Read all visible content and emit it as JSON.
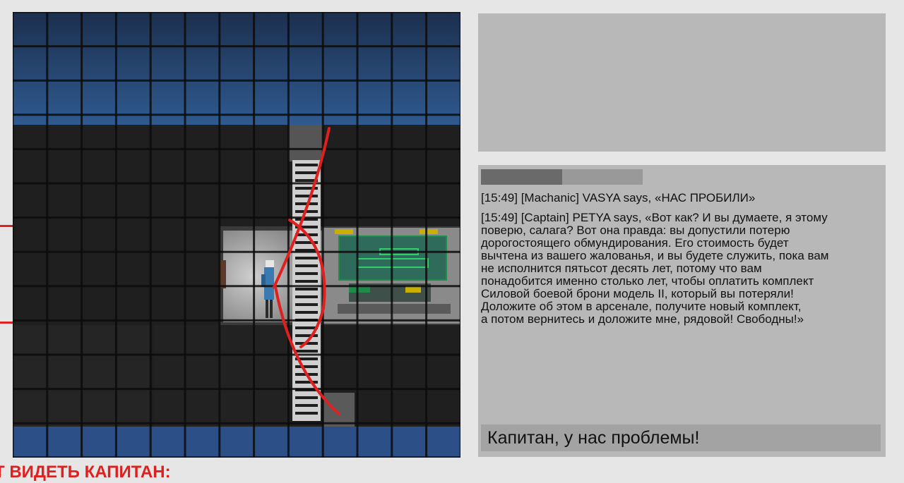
{
  "game": {
    "scene": "space-station-corridor",
    "sprites": [
      "captain-character",
      "ladder",
      "control-console",
      "red-annotation-lines"
    ],
    "colors": {
      "space": "#2a4c7a",
      "floor": "#1e1e1e",
      "room": "#9a9a9a",
      "console_screen": "#2f6b5a",
      "console_accent": "#1f8c4a",
      "highlight": "#c9b000",
      "annotation": "#e0201e"
    }
  },
  "status": {
    "health_level": 0.5
  },
  "chat": {
    "messages": [
      "[15:49] [Machanic] VASYA says, «НАС ПРОБИЛИ»",
      "[15:49] [Captain] PETYA says, «Вот как? И вы думаете, я этому\nповерю, салага? Вот она правда: вы допустили потерю\nдорогостоящего обмундирования. Его стоимость будет\nвычтена из вашего жалованья, и вы будете служить, пока вам\nне исполнится пятьсот десять лет, потому что вам\nпонадобится именно столько лет, чтобы оплатить комплект\nСиловой боевой брони модель II, который вы потеряли!\nДоложите об этом в арсенале, получите новый комплект,\nа потом вернитесь и доложите мне, рядовой! Свободны!»"
    ],
    "input_value": "Капитан, у нас проблемы!"
  },
  "caption": {
    "text": "Т ВИДЕТЬ КАПИТАН:"
  }
}
